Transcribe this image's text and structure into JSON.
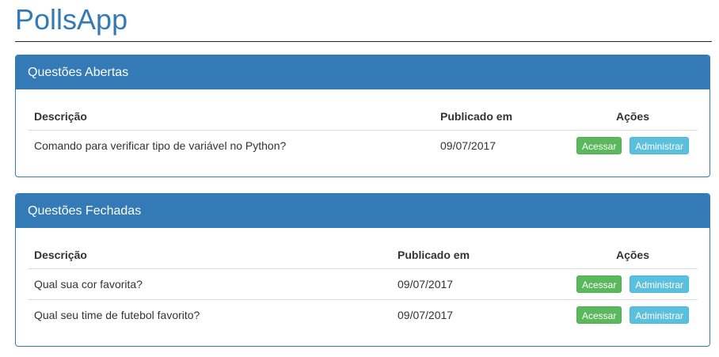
{
  "app": {
    "title": "PollsApp"
  },
  "open_questions": {
    "heading": "Questões Abertas",
    "columns": {
      "description": "Descrição",
      "published": "Publicado em",
      "actions": "Ações"
    },
    "rows": [
      {
        "description": "Comando para verificar tipo de variável no Python?",
        "published": "09/07/2017",
        "access_label": "Acessar",
        "admin_label": "Administrar"
      }
    ]
  },
  "closed_questions": {
    "heading": "Questões Fechadas",
    "columns": {
      "description": "Descrição",
      "published": "Publicado em",
      "actions": "Ações"
    },
    "rows": [
      {
        "description": "Qual sua cor favorita?",
        "published": "09/07/2017",
        "access_label": "Acessar",
        "admin_label": "Administrar"
      },
      {
        "description": "Qual seu time de futebol favorito?",
        "published": "09/07/2017",
        "access_label": "Acessar",
        "admin_label": "Administrar"
      }
    ]
  },
  "colors": {
    "primary": "#337ab7",
    "success": "#5cb85c",
    "info": "#5bc0de"
  }
}
